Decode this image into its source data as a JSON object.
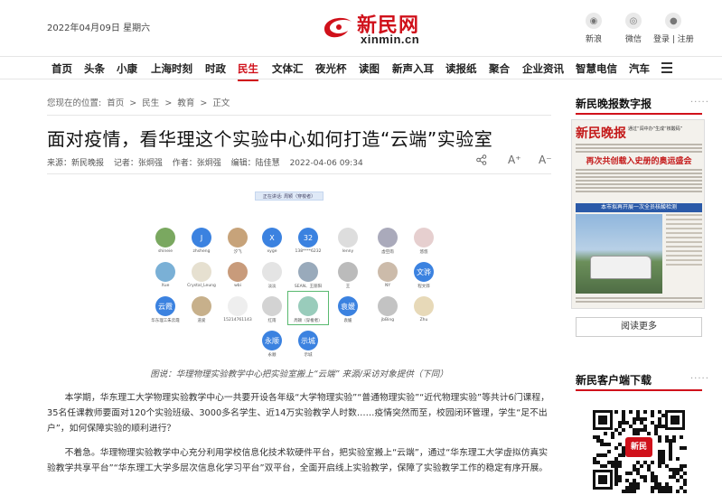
{
  "header": {
    "date": "2022年04月09日 星期六",
    "logo_cn": "新民网",
    "logo_en": "xinmin.cn",
    "social": [
      {
        "icon": "weibo-icon",
        "label": "新浪"
      },
      {
        "icon": "wechat-icon",
        "label": "微信"
      },
      {
        "icon": "user-icon",
        "label": "登录 | 注册"
      }
    ]
  },
  "nav": {
    "items": [
      "首页",
      "头条",
      "小康",
      "上海时刻",
      "时政",
      "民生",
      "文体汇",
      "夜光杯",
      "读图",
      "新声入耳",
      "读报纸",
      "聚合",
      "企业资讯",
      "智慧电信",
      "汽车"
    ],
    "active": "民生"
  },
  "breadcrumb": [
    "您现在的位置:",
    "首页",
    ">",
    "民生",
    ">",
    "教育",
    ">",
    "正文"
  ],
  "article": {
    "title": "面对疫情，看华理这个实验中心如何打造“云端”实验室",
    "source": "来源：新民晚报",
    "reporter": "记者：张炯强",
    "author": "作者：张炯强",
    "editor": "编辑：陆佳慧",
    "time": "2022-04-06 09:34",
    "font_up": "A⁺",
    "font_down": "A⁻",
    "caption": "图说：华理物理实验教学中心把实验室搬上“云端” 来源/采访对象提供（下同）",
    "para1": "本学期，华东理工大学物理实验教学中心一共要开设各年级“大学物理实验”“普通物理实验”“近代物理实验”等共计6门课程，35名任课教师要面对120个实验班级、3000多名学生、近14万实验教学人时数……疫情突然而至，校园闭环管理，学生“足不出户”，如何保障实验的顺利进行？",
    "para2": "不着急。华理物理实验教学中心充分利用学校信息化技术软硬件平台，把实验室搬上“云端”，通过“华东理工大学虚拟仿真实验教学共享平台”“华东理工大学多层次信息化学习平台”双平台，全面开启线上实验教学，保障了实验教学工作的稳定有序开展。"
  },
  "figure": {
    "top_bar": "正在讲话: 周颖（穿梭者）",
    "avatars": [
      {
        "text": "",
        "label": "shineie",
        "color": "#7aa860"
      },
      {
        "text": "J",
        "label": "zhsheng",
        "color": "#3b82e0"
      },
      {
        "text": "",
        "label": "汐飞",
        "color": "#c7a37a"
      },
      {
        "text": "X",
        "label": "xyge",
        "color": "#3b82e0"
      },
      {
        "text": "32",
        "label": "138****6232",
        "color": "#3b82e0"
      },
      {
        "text": "",
        "label": "lenny",
        "color": "#ddd"
      },
      {
        "text": "",
        "label": "虚空雨",
        "color": "#aab"
      },
      {
        "text": "",
        "label": "悠悠",
        "color": "#e6cfcf"
      },
      {
        "text": "",
        "label": "Xue",
        "color": "#7ab0d6"
      },
      {
        "text": "",
        "label": "Crystal_Leung",
        "color": "#e6e0d0"
      },
      {
        "text": "",
        "label": "wbi",
        "color": "#c89b7b"
      },
      {
        "text": "",
        "label": "淡淡",
        "color": "#e4e4e4"
      },
      {
        "text": "",
        "label": "SEAN、王丽阳",
        "color": "#9ab"
      },
      {
        "text": "",
        "label": "王",
        "color": "#bbb"
      },
      {
        "text": "",
        "label": "NY",
        "color": "#cba"
      },
      {
        "text": "文骅",
        "label": "程文骅",
        "color": "#3b82e0"
      },
      {
        "text": "云霞",
        "label": "华东理工朱云霞",
        "color": "#3b82e0"
      },
      {
        "text": "",
        "label": "道爱",
        "color": "#c7b08b"
      },
      {
        "text": "",
        "label": "15214761143",
        "color": "#eee"
      },
      {
        "text": "",
        "label": "红雨",
        "color": "#d3d3d3"
      },
      {
        "text": "",
        "label": "周颖（穿梭者）",
        "color": "#9cb"
      },
      {
        "text": "袁媛",
        "label": "袁媛",
        "color": "#3b82e0"
      },
      {
        "text": "",
        "label": "jbBing",
        "color": "#c3c3c3"
      },
      {
        "text": "",
        "label": "Zhu",
        "color": "#e7d9b8"
      },
      {
        "text": "永顺",
        "label": "永顺",
        "color": "#3b82e0"
      },
      {
        "text": "示城",
        "label": "示城",
        "color": "#3b82e0"
      }
    ]
  },
  "sidebar": {
    "paper_title": "新民晚报数字报",
    "paper_dots": "·····",
    "paper_masthead": "新民晚报",
    "paper_top_right": "通过“闯中办”生成“核酸码”",
    "paper_headline1": "再次共创载入史册的奥运盛会",
    "paper_headline2": "本市拟再开展一次全员核酸检测",
    "read_more": "阅读更多",
    "client_title": "新民客户端下载",
    "client_dots": "·····",
    "qr_logo": "新民"
  },
  "colors": {
    "brand": "#d0111b",
    "link_blue": "#3b82e0"
  }
}
